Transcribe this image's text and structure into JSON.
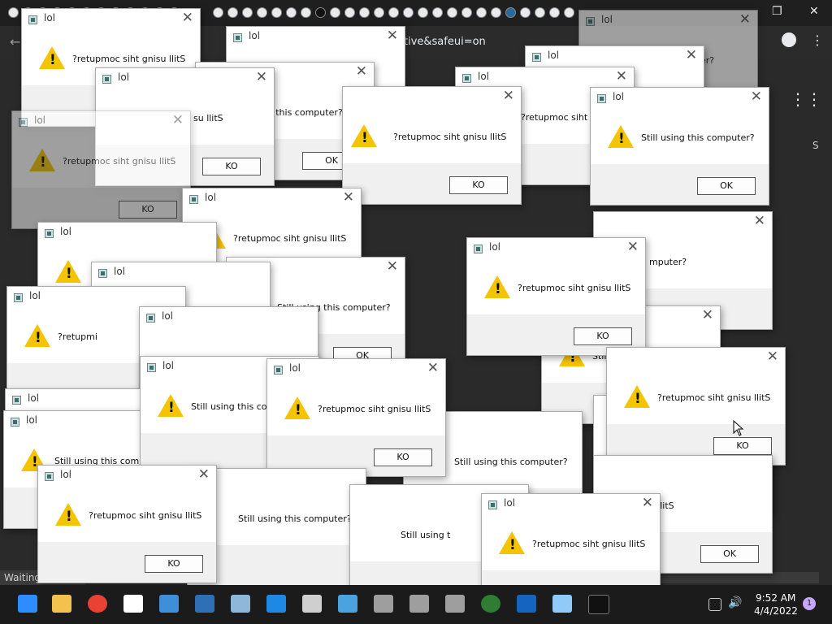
{
  "window_title": "lol",
  "browser": {
    "url_fragment": "tive&safeui=on"
  },
  "status_bar": "Waiting",
  "dialog": {
    "title": "lol",
    "close_glyph": "✕",
    "message_normal": "Still using this computer?",
    "message_reversed": "?retupmoc siht gnisu llitS",
    "button_ok": "OK",
    "button_ko": "KO"
  },
  "partial_texts": {
    "still_using_trunc": "Still using this comp",
    "still_using_trunc2": "Still using t",
    "reversed_trunc": "?retupmoc siht gn",
    "reversed_frag": "?retupmi",
    "reversed_frag2": "?retupmoc siht gnisu llitS",
    "still_frag": "Stil",
    "this_computer_frag": "his computer?",
    "computer_frag": "mputer?",
    "reversed_tail": "su llitS",
    "sing_frag": "sing this computer?",
    "r_frag": "S"
  },
  "taskbar": {
    "time": "9:52 AM",
    "date": "4/4/2022",
    "notification_count": "1"
  },
  "colors": {
    "warning": "#f5c400",
    "taskbar": "#1b1b1b",
    "dialog_body": "#ffffff",
    "dialog_footer": "#f0f0f0"
  }
}
